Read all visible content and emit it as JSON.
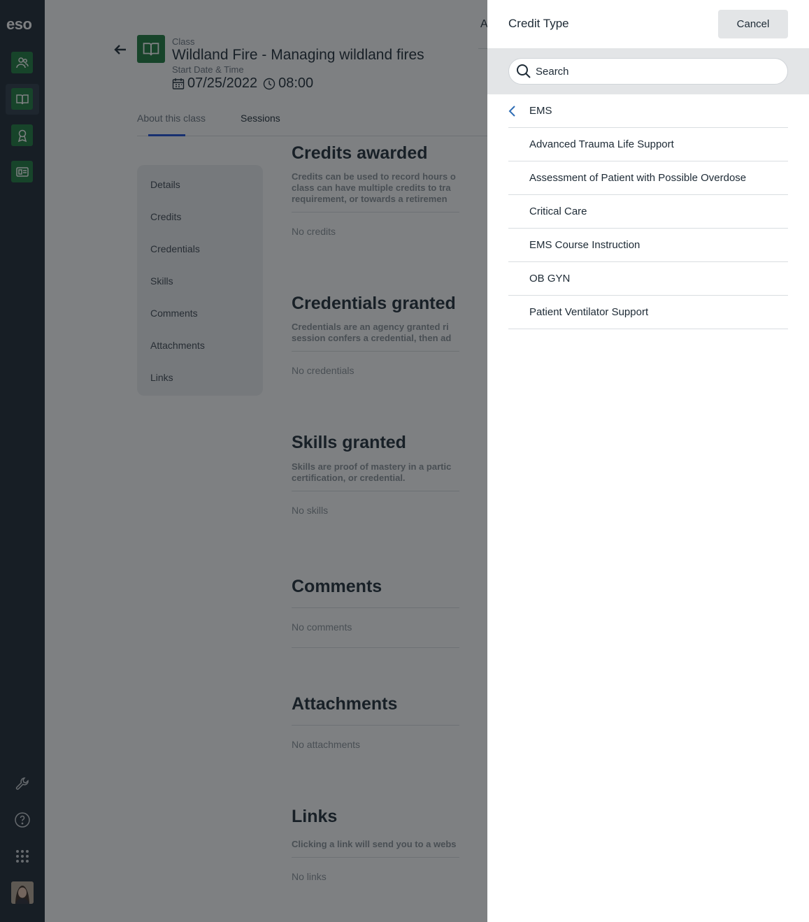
{
  "rail": {
    "logo": "eso",
    "items": [
      "people-icon",
      "book-icon",
      "award-icon",
      "id-card-icon"
    ],
    "bottom": [
      "wrench-icon",
      "help-icon",
      "apps-grid-icon"
    ]
  },
  "page": {
    "class_kicker": "Class",
    "class_title": "Wildland Fire - Managing wildland fires",
    "date_kicker": "Start Date & Time",
    "date": "07/25/2022",
    "time": "08:00",
    "header_right_text": "A",
    "tabs": [
      {
        "label": "About this class",
        "active": false
      },
      {
        "label": "Sessions",
        "active": true
      }
    ],
    "section_nav": [
      "Details",
      "Credits",
      "Credentials",
      "Skills",
      "Comments",
      "Attachments",
      "Links"
    ],
    "sections": {
      "credits": {
        "title": "Credits awarded",
        "desc": "Credits can be used to record hours o\nclass can have multiple credits to tra\nrequirement, or towards a retiremen",
        "empty": "No credits"
      },
      "credentials": {
        "title": "Credentials granted",
        "desc": "Credentials are an agency granted ri\nsession confers a credential, then ad",
        "empty": "No credentials"
      },
      "skills": {
        "title": "Skills granted",
        "desc": "Skills are proof of mastery in a partic\ncertification, or credential.",
        "empty": "No skills"
      },
      "comments": {
        "title": "Comments",
        "empty": "No comments"
      },
      "attachments": {
        "title": "Attachments",
        "empty": "No attachments"
      },
      "links": {
        "title": "Links",
        "desc": "Clicking a link will send you to a webs",
        "empty": "No links"
      }
    }
  },
  "panel": {
    "title": "Credit Type",
    "cancel_label": "Cancel",
    "search_placeholder": "Search",
    "breadcrumb": "EMS",
    "items": [
      "Advanced Trauma Life Support",
      "Assessment of Patient with Possible Overdose",
      "Critical Care",
      "EMS Course Instruction",
      "OB GYN",
      "Patient Ventilator Support"
    ]
  },
  "colors": {
    "rail_bg": "#1b2631",
    "brand_green": "#1c7a3d",
    "tab_accent": "#1d4ed8"
  }
}
